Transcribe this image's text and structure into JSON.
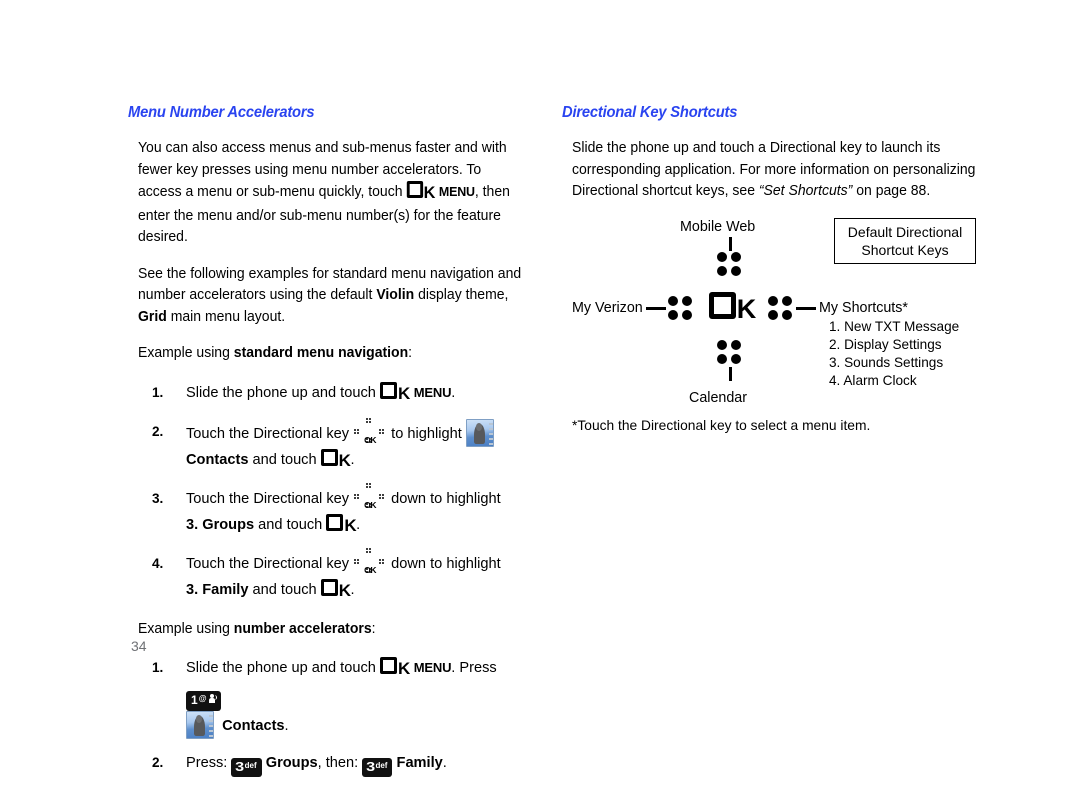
{
  "page_number": "34",
  "left_column": {
    "heading": "Menu Number Accelerators",
    "para1_a": "You can also access menus and sub-menus faster and with fewer key presses using menu number accelerators. To access a menu or sub-menu quickly, touch ",
    "para1_menu": "MENU",
    "para1_b": ", then enter the menu and/or sub-menu number(s) for the feature desired.",
    "para2_a": "See the following examples for standard menu navigation and number accelerators using the default ",
    "para2_violin": "Violin",
    "para2_b": " display theme, ",
    "para2_grid": "Grid",
    "para2_c": " main menu layout.",
    "example1_lead": "Example using ",
    "example1_bold": "standard menu navigation",
    "example1_colon": ":",
    "steps": [
      {
        "num": "1.",
        "text_a": "Slide the phone up and touch ",
        "menu": "MENU",
        "text_b": "."
      },
      {
        "num": "2.",
        "text_a": "Touch the Directional key ",
        "text_b": " to highlight ",
        "sub_bold": "Contacts",
        "sub_mid": " and touch ",
        "sub_end": "."
      },
      {
        "num": "3.",
        "text_a": "Touch the Directional key ",
        "text_b": " down to highlight ",
        "sub_bold": "3. Groups",
        "sub_mid": " and touch ",
        "sub_end": "."
      },
      {
        "num": "4.",
        "text_a": "Touch the Directional key ",
        "text_b": " down to highlight ",
        "sub_bold": "3. Family",
        "sub_mid": " and touch ",
        "sub_end": "."
      }
    ],
    "example2_lead": "Example using ",
    "example2_bold": "number accelerators",
    "example2_colon": ":",
    "steps2": [
      {
        "num": "1.",
        "text_a": "Slide the phone up and touch ",
        "menu": "MENU",
        "text_b": ". Press ",
        "key_digit": "1",
        "key_at": "@",
        "sub_bold": "Contacts",
        "sub_end": "."
      },
      {
        "num": "2.",
        "text_a": "Press: ",
        "key_digit": "3",
        "key_sup": "def",
        "text_b": "Groups",
        "text_c": ", then: ",
        "key2_digit": "3",
        "key2_sup": "def",
        "text_d": "Family",
        "text_e": "."
      }
    ]
  },
  "right_column": {
    "heading": "Directional Key Shortcuts",
    "para1_a": "Slide the phone up and touch a Directional key  to launch its corresponding application. For more information on personalizing Directional shortcut keys, see ",
    "para1_italic": "“Set Shortcuts”",
    "para1_b": " on page 88.",
    "diagram": {
      "label_up": "Mobile Web",
      "label_down": "Calendar",
      "label_left": "My Verizon",
      "label_right": "My Shortcuts*",
      "center": "OK",
      "center_k": "K",
      "legend_line1": "Default Directional",
      "legend_line2": "Shortcut Keys",
      "shortcut_list": [
        "1. New TXT Message",
        "2. Display Settings",
        "3. Sounds Settings",
        "4. Alarm Clock"
      ]
    },
    "footnote": "*Touch the Directional key to select a menu item."
  }
}
